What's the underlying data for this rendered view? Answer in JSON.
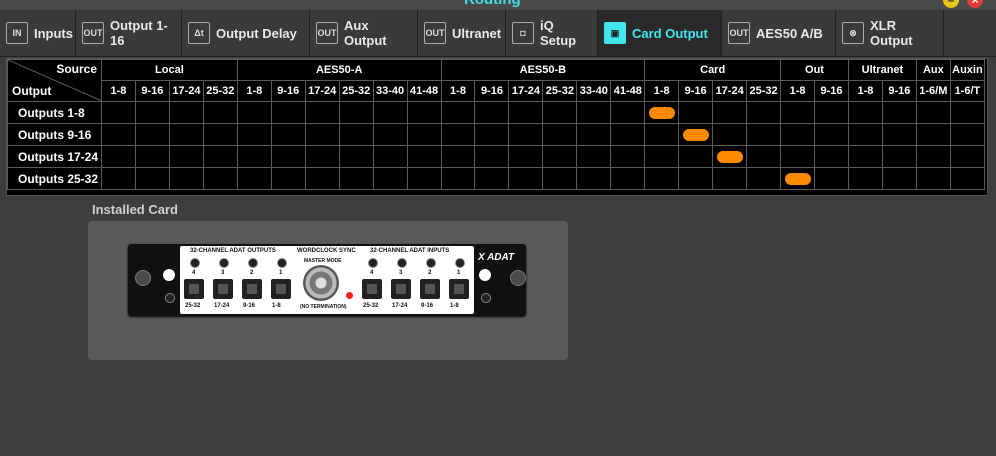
{
  "window": {
    "title": "Routing",
    "minimize_icon": "minimize-icon",
    "close_icon": "close-icon"
  },
  "tabs": [
    {
      "label": "Inputs",
      "icon": "IN",
      "active": false
    },
    {
      "label": "Output 1-16",
      "icon": "OUT",
      "active": false
    },
    {
      "label": "Output Delay",
      "icon": "Δt",
      "active": false
    },
    {
      "label": "Aux Output",
      "icon": "OUT",
      "active": false
    },
    {
      "label": "Ultranet",
      "icon": "OUT",
      "active": false
    },
    {
      "label": "iQ Setup",
      "icon": "◘",
      "active": false
    },
    {
      "label": "Card Output",
      "icon": "▣",
      "active": true
    },
    {
      "label": "AES50 A/B",
      "icon": "OUT",
      "active": false
    },
    {
      "label": "XLR Output",
      "icon": "⊗",
      "active": false
    }
  ],
  "matrix": {
    "corner_source": "Source",
    "corner_output": "Output",
    "groups": [
      {
        "label": "Local",
        "span": 4
      },
      {
        "label": "AES50-A",
        "span": 6
      },
      {
        "label": "AES50-B",
        "span": 6
      },
      {
        "label": "Card",
        "span": 4
      },
      {
        "label": "Out",
        "span": 2
      },
      {
        "label": "Ultranet",
        "span": 2
      },
      {
        "label": "Aux",
        "span": 1
      },
      {
        "label": "Auxin",
        "span": 1
      }
    ],
    "columns": [
      "1-8",
      "9-16",
      "17-24",
      "25-32",
      "1-8",
      "9-16",
      "17-24",
      "25-32",
      "33-40",
      "41-48",
      "1-8",
      "9-16",
      "17-24",
      "25-32",
      "33-40",
      "41-48",
      "1-8",
      "9-16",
      "17-24",
      "25-32",
      "1-8",
      "9-16",
      "1-8",
      "9-16",
      "1-6/M",
      "1-6/T"
    ],
    "rows": [
      {
        "label": "Outputs 1-8",
        "selected": 16
      },
      {
        "label": "Outputs 9-16",
        "selected": 17
      },
      {
        "label": "Outputs 17-24",
        "selected": 18
      },
      {
        "label": "Outputs 25-32",
        "selected": 20
      }
    ],
    "selection_color": "#ff8a00"
  },
  "installed_card": {
    "section_label": "Installed Card",
    "outputs_title": "32-CHANNEL ADAT OUTPUTS",
    "inputs_title": "32-CHANNEL ADAT INPUTS",
    "wordclock_title": "WORDCLOCK SYNC",
    "master_mode": "MASTER MODE",
    "no_termination": "(NO TERMINATION)",
    "port_numbers": [
      "4",
      "3",
      "2",
      "1"
    ],
    "port_ranges": [
      "25-32",
      "17-24",
      "9-16",
      "1-8"
    ],
    "logo": "X ADAT"
  }
}
